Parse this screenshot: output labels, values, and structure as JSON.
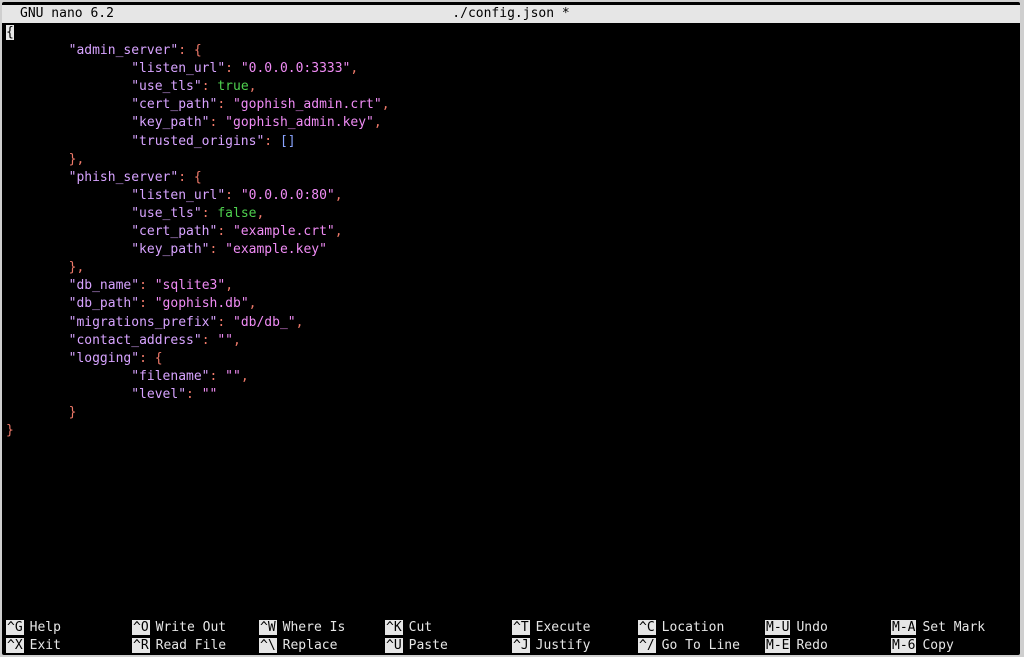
{
  "title": {
    "app": "GNU nano 6.2",
    "file": "./config.json *"
  },
  "editor": {
    "lines": [
      [
        {
          "t": "{",
          "c": "cursor"
        }
      ],
      [
        {
          "t": "        "
        },
        {
          "t": "\"admin_server\"",
          "c": "k"
        },
        {
          "t": ": ",
          "c": "p"
        },
        {
          "t": "{",
          "c": "p"
        }
      ],
      [
        {
          "t": "                "
        },
        {
          "t": "\"listen_url\"",
          "c": "k"
        },
        {
          "t": ": ",
          "c": "p"
        },
        {
          "t": "\"0.0.0.0:3333\"",
          "c": "s"
        },
        {
          "t": ",",
          "c": "p"
        }
      ],
      [
        {
          "t": "                "
        },
        {
          "t": "\"use_tls\"",
          "c": "k"
        },
        {
          "t": ": ",
          "c": "p"
        },
        {
          "t": "true",
          "c": "b"
        },
        {
          "t": ",",
          "c": "p"
        }
      ],
      [
        {
          "t": "                "
        },
        {
          "t": "\"cert_path\"",
          "c": "k"
        },
        {
          "t": ": ",
          "c": "p"
        },
        {
          "t": "\"gophish_admin.crt\"",
          "c": "s"
        },
        {
          "t": ",",
          "c": "p"
        }
      ],
      [
        {
          "t": "                "
        },
        {
          "t": "\"key_path\"",
          "c": "k"
        },
        {
          "t": ": ",
          "c": "p"
        },
        {
          "t": "\"gophish_admin.key\"",
          "c": "s"
        },
        {
          "t": ",",
          "c": "p"
        }
      ],
      [
        {
          "t": "                "
        },
        {
          "t": "\"trusted_origins\"",
          "c": "k"
        },
        {
          "t": ": ",
          "c": "p"
        },
        {
          "t": "[]",
          "c": "arr"
        }
      ],
      [
        {
          "t": "        "
        },
        {
          "t": "},",
          "c": "p"
        }
      ],
      [
        {
          "t": "        "
        },
        {
          "t": "\"phish_server\"",
          "c": "k"
        },
        {
          "t": ": ",
          "c": "p"
        },
        {
          "t": "{",
          "c": "p"
        }
      ],
      [
        {
          "t": "                "
        },
        {
          "t": "\"listen_url\"",
          "c": "k"
        },
        {
          "t": ": ",
          "c": "p"
        },
        {
          "t": "\"0.0.0.0:80\"",
          "c": "s"
        },
        {
          "t": ",",
          "c": "p"
        }
      ],
      [
        {
          "t": "                "
        },
        {
          "t": "\"use_tls\"",
          "c": "k"
        },
        {
          "t": ": ",
          "c": "p"
        },
        {
          "t": "false",
          "c": "b"
        },
        {
          "t": ",",
          "c": "p"
        }
      ],
      [
        {
          "t": "                "
        },
        {
          "t": "\"cert_path\"",
          "c": "k"
        },
        {
          "t": ": ",
          "c": "p"
        },
        {
          "t": "\"example.crt\"",
          "c": "s"
        },
        {
          "t": ",",
          "c": "p"
        }
      ],
      [
        {
          "t": "                "
        },
        {
          "t": "\"key_path\"",
          "c": "k"
        },
        {
          "t": ": ",
          "c": "p"
        },
        {
          "t": "\"example.key\"",
          "c": "s"
        }
      ],
      [
        {
          "t": "        "
        },
        {
          "t": "},",
          "c": "p"
        }
      ],
      [
        {
          "t": "        "
        },
        {
          "t": "\"db_name\"",
          "c": "k"
        },
        {
          "t": ": ",
          "c": "p"
        },
        {
          "t": "\"sqlite3\"",
          "c": "s"
        },
        {
          "t": ",",
          "c": "p"
        }
      ],
      [
        {
          "t": "        "
        },
        {
          "t": "\"db_path\"",
          "c": "k"
        },
        {
          "t": ": ",
          "c": "p"
        },
        {
          "t": "\"gophish.db\"",
          "c": "s"
        },
        {
          "t": ",",
          "c": "p"
        }
      ],
      [
        {
          "t": "        "
        },
        {
          "t": "\"migrations_prefix\"",
          "c": "k"
        },
        {
          "t": ": ",
          "c": "p"
        },
        {
          "t": "\"db/db_\"",
          "c": "s"
        },
        {
          "t": ",",
          "c": "p"
        }
      ],
      [
        {
          "t": "        "
        },
        {
          "t": "\"contact_address\"",
          "c": "k"
        },
        {
          "t": ": ",
          "c": "p"
        },
        {
          "t": "\"\"",
          "c": "s"
        },
        {
          "t": ",",
          "c": "p"
        }
      ],
      [
        {
          "t": "        "
        },
        {
          "t": "\"logging\"",
          "c": "k"
        },
        {
          "t": ": ",
          "c": "p"
        },
        {
          "t": "{",
          "c": "p"
        }
      ],
      [
        {
          "t": "                "
        },
        {
          "t": "\"filename\"",
          "c": "k"
        },
        {
          "t": ": ",
          "c": "p"
        },
        {
          "t": "\"\"",
          "c": "s"
        },
        {
          "t": ",",
          "c": "p"
        }
      ],
      [
        {
          "t": "                "
        },
        {
          "t": "\"level\"",
          "c": "k"
        },
        {
          "t": ": ",
          "c": "p"
        },
        {
          "t": "\"\"",
          "c": "s"
        }
      ],
      [
        {
          "t": "        "
        },
        {
          "t": "}",
          "c": "p"
        }
      ],
      [
        {
          "t": "}",
          "c": "p"
        }
      ]
    ]
  },
  "shortcuts": {
    "row1": [
      {
        "key": "^G",
        "label": "Help"
      },
      {
        "key": "^O",
        "label": "Write Out"
      },
      {
        "key": "^W",
        "label": "Where Is"
      },
      {
        "key": "^K",
        "label": "Cut"
      },
      {
        "key": "^T",
        "label": "Execute"
      },
      {
        "key": "^C",
        "label": "Location"
      },
      {
        "key": "M-U",
        "label": "Undo"
      },
      {
        "key": "M-A",
        "label": "Set Mark"
      }
    ],
    "row2": [
      {
        "key": "^X",
        "label": "Exit"
      },
      {
        "key": "^R",
        "label": "Read File"
      },
      {
        "key": "^\\",
        "label": "Replace"
      },
      {
        "key": "^U",
        "label": "Paste"
      },
      {
        "key": "^J",
        "label": "Justify"
      },
      {
        "key": "^/",
        "label": "Go To Line"
      },
      {
        "key": "M-E",
        "label": "Redo"
      },
      {
        "key": "M-6",
        "label": "Copy"
      }
    ]
  },
  "colors": {
    "background": "#000000",
    "titlebar": "#e6e6e6",
    "key_string": "#d7a3ff",
    "value_string": "#f08cf5",
    "punctuation": "#f07a6a",
    "boolean": "#4fd14f"
  }
}
